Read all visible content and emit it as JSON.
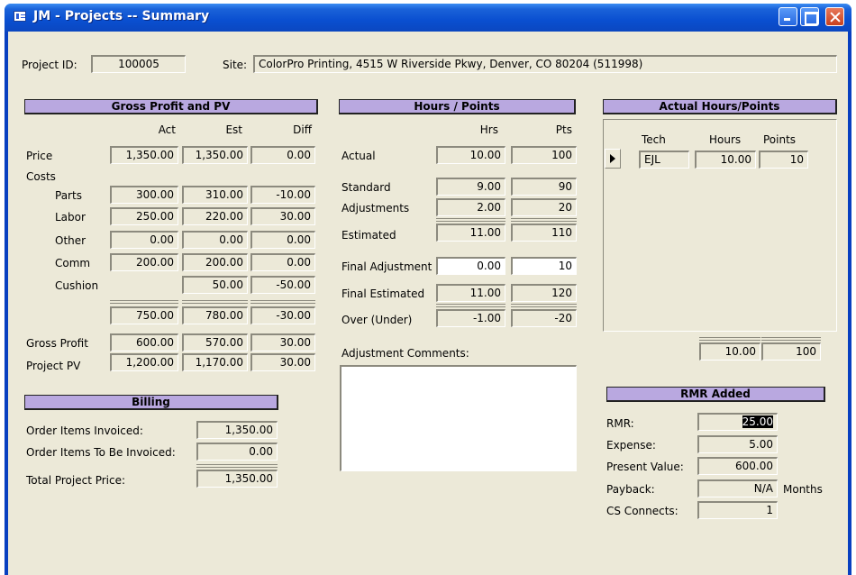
{
  "window": {
    "title": "JM - Projects -- Summary"
  },
  "top": {
    "project_id_label": "Project ID:",
    "project_id": "100005",
    "site_label": "Site:",
    "site": "ColorPro Printing, 4515 W Riverside Pkwy, Denver, CO  80204 (511998)"
  },
  "gross": {
    "header": "Gross Profit and PV",
    "col_act": "Act",
    "col_est": "Est",
    "col_diff": "Diff",
    "price_label": "Price",
    "price": {
      "act": "1,350.00",
      "est": "1,350.00",
      "diff": "0.00"
    },
    "costs_label": "Costs",
    "parts_label": "Parts",
    "parts": {
      "act": "300.00",
      "est": "310.00",
      "diff": "-10.00"
    },
    "labor_label": "Labor",
    "labor": {
      "act": "250.00",
      "est": "220.00",
      "diff": "30.00"
    },
    "other_label": "Other",
    "other": {
      "act": "0.00",
      "est": "0.00",
      "diff": "0.00"
    },
    "comm_label": "Comm",
    "comm": {
      "act": "200.00",
      "est": "200.00",
      "diff": "0.00"
    },
    "cushion_label": "Cushion",
    "cushion": {
      "est": "50.00",
      "diff": "-50.00"
    },
    "total": {
      "act": "750.00",
      "est": "780.00",
      "diff": "-30.00"
    },
    "gp_label": "Gross Profit",
    "gp": {
      "act": "600.00",
      "est": "570.00",
      "diff": "30.00"
    },
    "pv_label": "Project PV",
    "pv": {
      "act": "1,200.00",
      "est": "1,170.00",
      "diff": "30.00"
    }
  },
  "billing": {
    "header": "Billing",
    "invoiced_label": "Order Items Invoiced:",
    "invoiced": "1,350.00",
    "tobe_label": "Order Items To Be Invoiced:",
    "tobe": "0.00",
    "total_label": "Total Project Price:",
    "total": "1,350.00"
  },
  "hours": {
    "header": "Hours / Points",
    "col_hrs": "Hrs",
    "col_pts": "Pts",
    "actual_label": "Actual",
    "actual": {
      "hrs": "10.00",
      "pts": "100"
    },
    "standard_label": "Standard",
    "standard": {
      "hrs": "9.00",
      "pts": "90"
    },
    "adjust_label": "Adjustments",
    "adjust": {
      "hrs": "2.00",
      "pts": "20"
    },
    "estimated_label": "Estimated",
    "estimated": {
      "hrs": "11.00",
      "pts": "110"
    },
    "final_adj_label": "Final Adjustment",
    "final_adj": {
      "hrs": "0.00",
      "pts": "10"
    },
    "final_est_label": "Final Estimated",
    "final_est": {
      "hrs": "11.00",
      "pts": "120"
    },
    "over_label": "Over (Under)",
    "over": {
      "hrs": "-1.00",
      "pts": "-20"
    },
    "comments_label": "Adjustment Comments:"
  },
  "actual_hp": {
    "header": "Actual Hours/Points",
    "col_tech": "Tech",
    "col_hours": "Hours",
    "col_points": "Points",
    "rows": [
      {
        "tech": "EJL",
        "hours": "10.00",
        "points": "10"
      }
    ],
    "total_hours": "10.00",
    "total_points": "100"
  },
  "rmr": {
    "header": "RMR Added",
    "rmr_label": "RMR:",
    "rmr": "25.00",
    "expense_label": "Expense:",
    "expense": "5.00",
    "pv_label": "Present Value:",
    "pv": "600.00",
    "payback_label": "Payback:",
    "payback": "N/A",
    "payback_unit": "Months",
    "cs_label": "CS Connects:",
    "cs": "1"
  }
}
